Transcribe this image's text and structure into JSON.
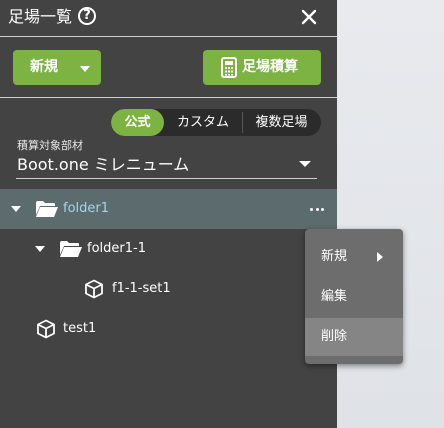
{
  "panel": {
    "title": "足場一覧",
    "help_icon": "?",
    "close_icon": "close-icon"
  },
  "toolbar": {
    "new_label": "新規",
    "calc_label": "足場積算",
    "calc_icon": "calculator-icon",
    "brand_color": "#7cb342"
  },
  "mode_tabs": [
    {
      "label": "公式",
      "selected": true
    },
    {
      "label": "カスタム",
      "selected": false
    },
    {
      "label": "複数足場",
      "selected": false
    }
  ],
  "material": {
    "label": "積算対象部材",
    "value": "Boot.one ミレニューム"
  },
  "tree": [
    {
      "label": "folder1",
      "type": "folder",
      "expanded": true,
      "selected": true
    },
    {
      "label": "folder1-1",
      "type": "folder",
      "expanded": true,
      "selected": false
    },
    {
      "label": "f1-1-set1",
      "type": "set",
      "selected": false
    },
    {
      "label": "test1",
      "type": "set",
      "selected": false
    }
  ],
  "context_menu": {
    "items": [
      {
        "label": "新規",
        "has_submenu": true
      },
      {
        "label": "編集",
        "has_submenu": false
      },
      {
        "label": "削除",
        "has_submenu": false,
        "highlighted": true
      }
    ]
  }
}
